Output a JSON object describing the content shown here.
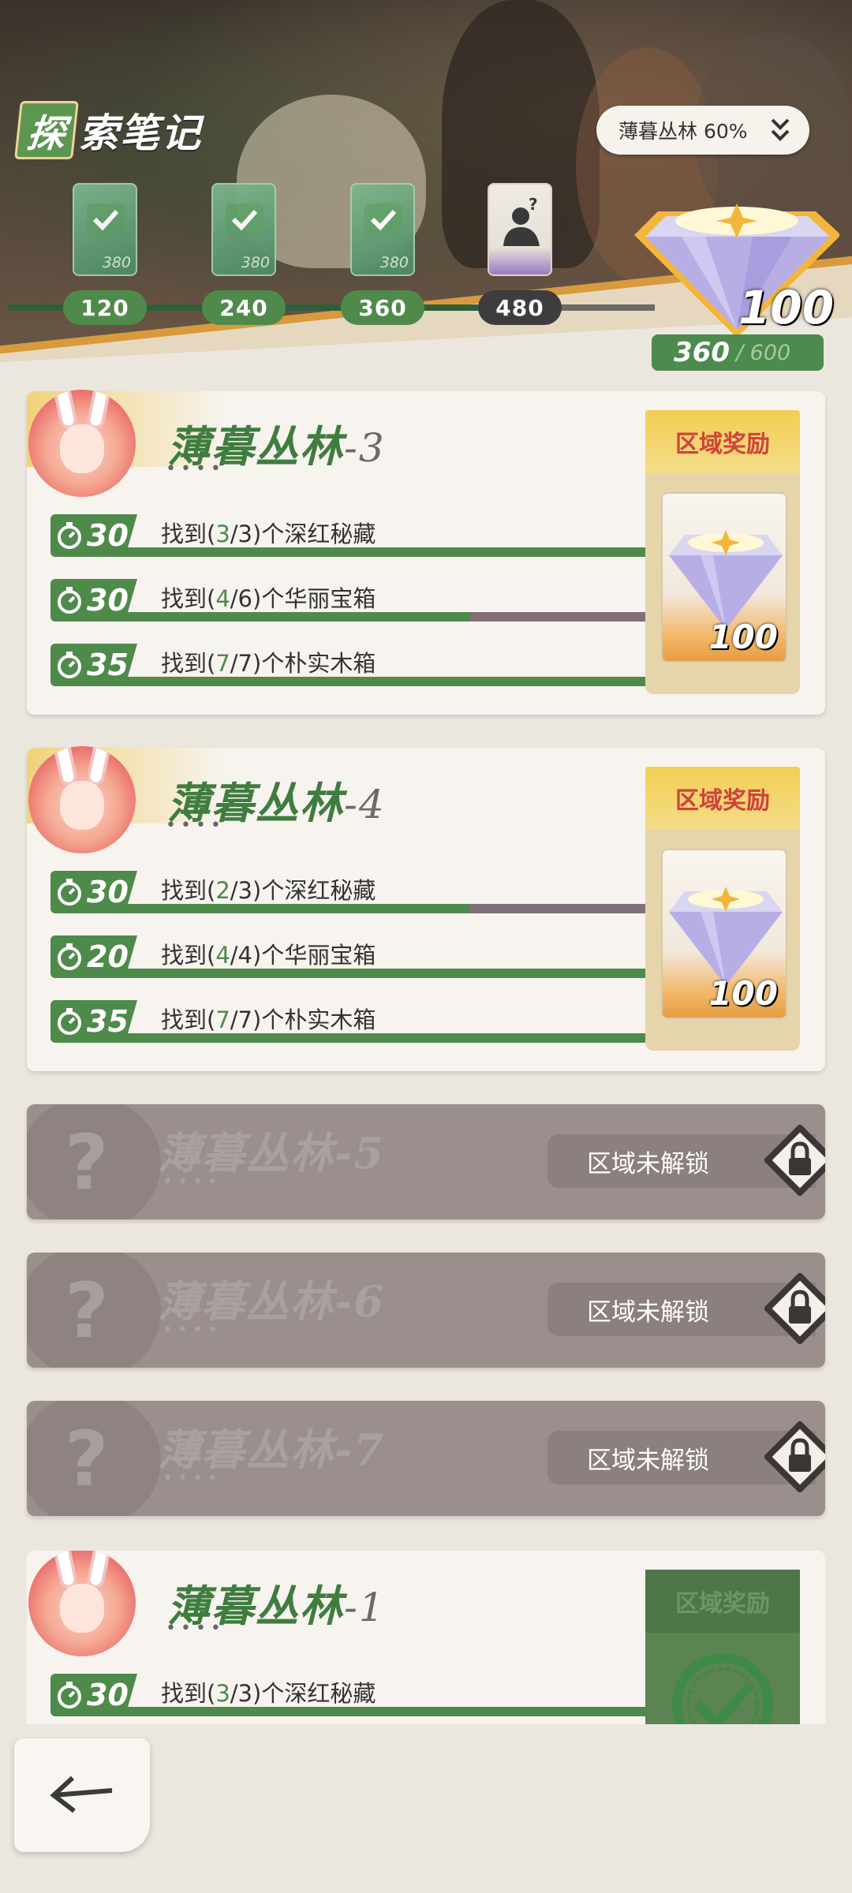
{
  "header": {
    "title_first_char": "探",
    "title_rest": "索笔记",
    "region_selector": "薄暮丛林 60%",
    "milestones": [
      {
        "threshold": "120",
        "reward_amount": "380",
        "claimed": true
      },
      {
        "threshold": "240",
        "reward_amount": "380",
        "claimed": true
      },
      {
        "threshold": "360",
        "reward_amount": "380",
        "claimed": true
      },
      {
        "threshold": "480",
        "reward_amount": "",
        "claimed": false
      }
    ],
    "big_reward_count": "100",
    "progress_current": "360",
    "progress_total": "/ 600"
  },
  "cards": [
    {
      "title": "薄暮丛林",
      "suffix": "-3",
      "dots": "••••",
      "reward_label": "区域奖励",
      "reward_count": "100",
      "tasks": [
        {
          "points": "30",
          "prefix": "找到(",
          "count": "3",
          "rest": "/3)个深红秘藏",
          "progress": 1.0
        },
        {
          "points": "30",
          "prefix": "找到(",
          "count": "4",
          "rest": "/6)个华丽宝箱",
          "progress": 0.667
        },
        {
          "points": "35",
          "prefix": "找到(",
          "count": "7",
          "rest": "/7)个朴实木箱",
          "progress": 1.0
        }
      ]
    },
    {
      "title": "薄暮丛林",
      "suffix": "-4",
      "dots": "••••",
      "reward_label": "区域奖励",
      "reward_count": "100",
      "tasks": [
        {
          "points": "30",
          "prefix": "找到(",
          "count": "2",
          "rest": "/3)个深红秘藏",
          "progress": 0.667
        },
        {
          "points": "20",
          "prefix": "找到(",
          "count": "4",
          "rest": "/4)个华丽宝箱",
          "progress": 1.0
        },
        {
          "points": "35",
          "prefix": "找到(",
          "count": "7",
          "rest": "/7)个朴实木箱",
          "progress": 1.0
        }
      ]
    }
  ],
  "locked": [
    {
      "title": "薄暮丛林-5",
      "dots": "••••",
      "status": "区域未解锁"
    },
    {
      "title": "薄暮丛林-6",
      "dots": "••••",
      "status": "区域未解锁"
    },
    {
      "title": "薄暮丛林-7",
      "dots": "••••",
      "status": "区域未解锁"
    }
  ],
  "card_bottom": {
    "title": "薄暮丛林",
    "suffix": "-1",
    "dots": "••••",
    "reward_label": "区域奖励",
    "task": {
      "points": "30",
      "prefix": "找到(",
      "count": "3",
      "rest": "/3)个深红秘藏",
      "progress": 1.0
    }
  },
  "colors": {
    "accent_green": "#4e8b4b",
    "reward_red": "#d1423c",
    "locked_gray": "#9a8f8c"
  },
  "icons": [
    "checkmark-icon",
    "mystery-person-icon",
    "diamond-icon",
    "stopwatch-icon",
    "lock-icon",
    "back-arrow-icon",
    "chevron-down-icon"
  ]
}
